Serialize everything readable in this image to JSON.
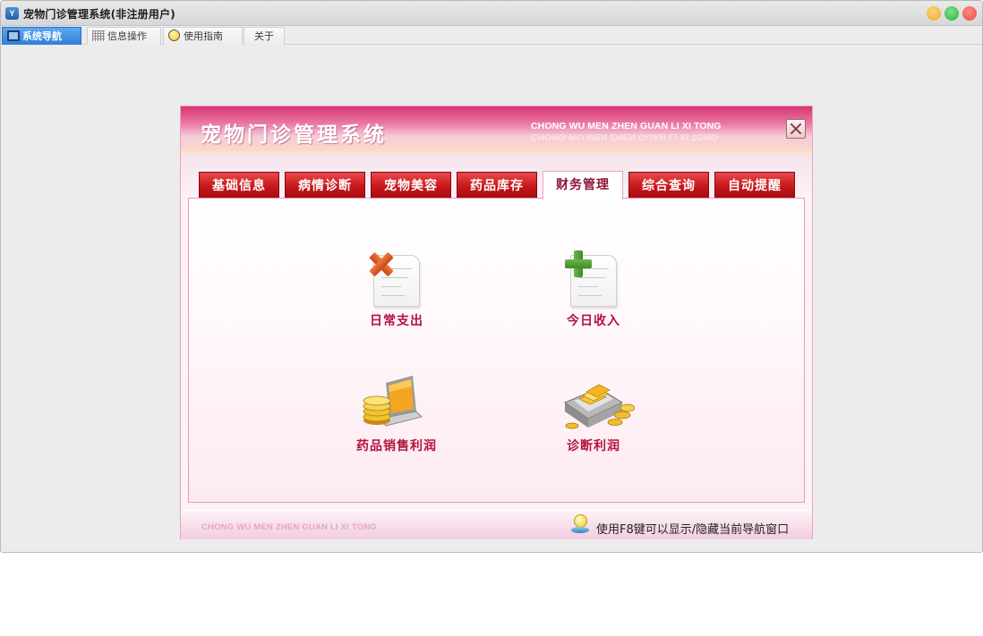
{
  "window": {
    "title": "宠物门诊管理系统(非注册用户)",
    "app_icon_text": "Y"
  },
  "main_tabs": [
    {
      "label": "系统导航",
      "active": true,
      "icon": "monitor-icon"
    },
    {
      "label": "信息操作",
      "active": false,
      "icon": "grid-icon"
    },
    {
      "label": "使用指南",
      "active": false,
      "icon": "bulb-icon"
    },
    {
      "label": "关于",
      "active": false,
      "icon": ""
    }
  ],
  "panel": {
    "title": "宠物门诊管理系统",
    "subtitle": "CHONG WU MEN ZHEN GUAN LI XI TONG",
    "close_icon": "close-icon"
  },
  "panel_tabs": [
    {
      "label": "基础信息",
      "active": false
    },
    {
      "label": "病情诊断",
      "active": false
    },
    {
      "label": "宠物美容",
      "active": false
    },
    {
      "label": "药品库存",
      "active": false
    },
    {
      "label": "财务管理",
      "active": true
    },
    {
      "label": "综合查询",
      "active": false
    },
    {
      "label": "自动提醒",
      "active": false
    }
  ],
  "tools": [
    {
      "label": "日常支出",
      "icon": "document-remove-icon"
    },
    {
      "label": "今日收入",
      "icon": "document-add-icon"
    },
    {
      "label": "药品销售利润",
      "icon": "laptop-coins-icon"
    },
    {
      "label": "诊断利润",
      "icon": "cash-box-coins-icon"
    }
  ],
  "footer": {
    "left_text": "CHONG WU MEN ZHEN  GUAN LI XI TONG",
    "hint_text": "使用F8键可以显示/隐藏当前导航窗口",
    "hint_icon": "lightbulb-icon"
  },
  "colors": {
    "header_accent": "#d73573",
    "tab_red": "#c8161a",
    "label_red": "#b3133e",
    "active_main_tab": "#2f7fd8"
  }
}
